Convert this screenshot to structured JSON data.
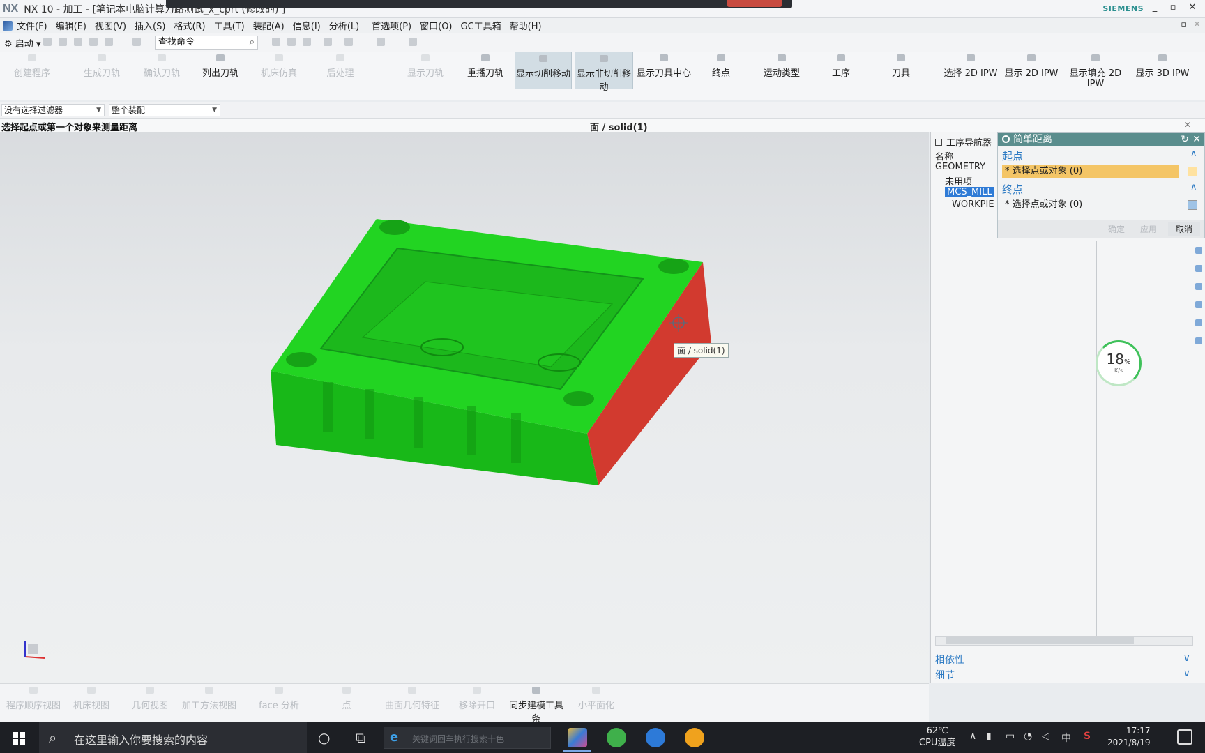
{
  "window": {
    "logo": "NX",
    "title": "NX 10 - 加工 - [笔记本电脑计算刀路测试_x_cprt  (修改的) ]",
    "brand": "SIEMENS",
    "minimize": "_",
    "restore": "▫",
    "close": "✕"
  },
  "menu": {
    "items": [
      "文件(F)",
      "编辑(E)",
      "视图(V)",
      "插入(S)",
      "格式(R)",
      "工具(T)",
      "装配(A)",
      "信息(I)",
      "分析(L)",
      "首选项(P)",
      "窗口(O)",
      "GC工具箱",
      "帮助(H)"
    ]
  },
  "command_row": {
    "start": "启动",
    "find_placeholder": "查找命令",
    "search_icon": "magnifier-icon"
  },
  "ribbon": {
    "buttons": [
      {
        "label": "创建程序",
        "state": "disabled"
      },
      {
        "label": "生成刀轨",
        "state": "disabled"
      },
      {
        "label": "确认刀轨",
        "state": "disabled"
      },
      {
        "label": "列出刀轨",
        "state": "normal"
      },
      {
        "label": "机床仿真",
        "state": "disabled"
      },
      {
        "label": "后处理",
        "state": "disabled"
      },
      {
        "label": "显示刀轨",
        "state": "disabled"
      },
      {
        "label": "重播刀轨",
        "state": "normal"
      },
      {
        "label": "显示切削移动",
        "state": "active"
      },
      {
        "label": "显示非切削移动",
        "state": "active"
      },
      {
        "label": "显示刀具中心",
        "state": "normal"
      },
      {
        "label": "终点",
        "state": "normal"
      },
      {
        "label": "运动类型",
        "state": "normal"
      },
      {
        "label": "工序",
        "state": "normal"
      },
      {
        "label": "刀具",
        "state": "normal"
      },
      {
        "label": "选择 2D IPW",
        "state": "normal"
      },
      {
        "label": "显示 2D IPW",
        "state": "normal"
      },
      {
        "label": "显示填充 2D IPW",
        "state": "normal"
      },
      {
        "label": "显示 3D IPW",
        "state": "normal"
      }
    ]
  },
  "filter": {
    "type_filter": "没有选择过滤器",
    "scope": "整个装配"
  },
  "status": {
    "prompt": "选择起点或第一个对象来测量距离",
    "selection": "面 / solid(1)"
  },
  "viewport": {
    "hover_label": "面 / solid(1)",
    "model_color": "#1fd11f",
    "side_color": "#d23a2f"
  },
  "navigator": {
    "title": "工序导航器",
    "column": "名称",
    "items": [
      "GEOMETRY",
      "未用项",
      "MCS_MILL",
      "WORKPIECE"
    ],
    "dependencies": "相依性",
    "details": "细节"
  },
  "dialog": {
    "title": "简单距离",
    "start_section": "起点",
    "start_select": "选择点或对象 (0)",
    "end_section": "终点",
    "end_select": "选择点或对象 (0)",
    "ok": "确定",
    "apply": "应用",
    "cancel": "取消"
  },
  "progress": {
    "percent": "18",
    "unit": "%",
    "rate": "K/s"
  },
  "bottom_ribbon": {
    "buttons": [
      {
        "label": "程序顺序视图",
        "state": "disabled"
      },
      {
        "label": "机床视图",
        "state": "disabled"
      },
      {
        "label": "几何视图",
        "state": "disabled"
      },
      {
        "label": "加工方法视图",
        "state": "disabled"
      },
      {
        "label": "face 分析",
        "state": "disabled"
      },
      {
        "label": "点",
        "state": "disabled"
      },
      {
        "label": "曲面几何特征",
        "state": "disabled"
      },
      {
        "label": "移除开口",
        "state": "disabled"
      },
      {
        "label": "同步建模工具条",
        "state": "normal"
      },
      {
        "label": "小平面化",
        "state": "disabled"
      }
    ]
  },
  "taskbar": {
    "search_text": "在这里输入你要搜索的内容",
    "address_placeholder": "关键词回车执行搜索十色",
    "temp_value": "62℃",
    "temp_label": "CPU温度",
    "ime": "中",
    "time": "17:17",
    "date": "2021/8/19"
  }
}
